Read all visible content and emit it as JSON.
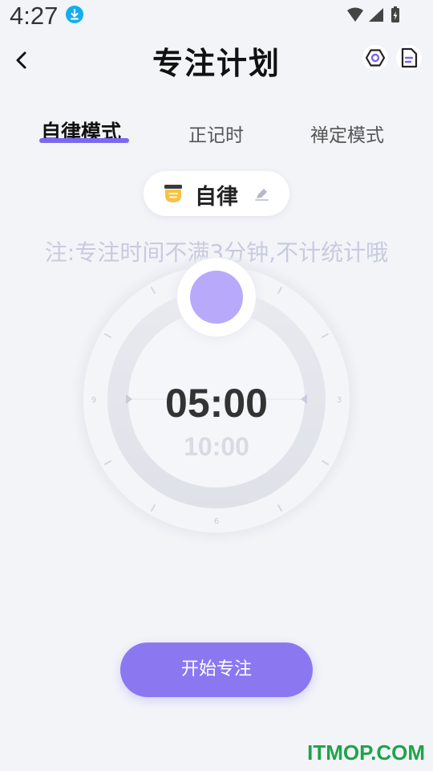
{
  "status_bar": {
    "time": "4:27"
  },
  "header": {
    "title": "专注计划"
  },
  "tabs": [
    {
      "label": "自律模式",
      "active": true
    },
    {
      "label": "正记时",
      "active": false
    },
    {
      "label": "禅定模式",
      "active": false
    }
  ],
  "mode_chip": {
    "label": "自律"
  },
  "note": "注:专注时间不满3分钟,不计统计哦",
  "timer": {
    "current": "05:00",
    "next": "10:00",
    "dial_labels": [
      "3",
      "6",
      "9"
    ]
  },
  "start_button": {
    "label": "开始专注"
  },
  "watermark": "ITMOP.COM",
  "colors": {
    "accent": "#8b78f0",
    "background": "#f3f4f8",
    "knob": "#b8a9fb"
  },
  "icons": [
    "download-icon",
    "wifi-icon",
    "signal-icon",
    "battery-icon",
    "back-arrow-icon",
    "hexagon-settings-icon",
    "document-icon",
    "note-icon",
    "pencil-icon"
  ]
}
